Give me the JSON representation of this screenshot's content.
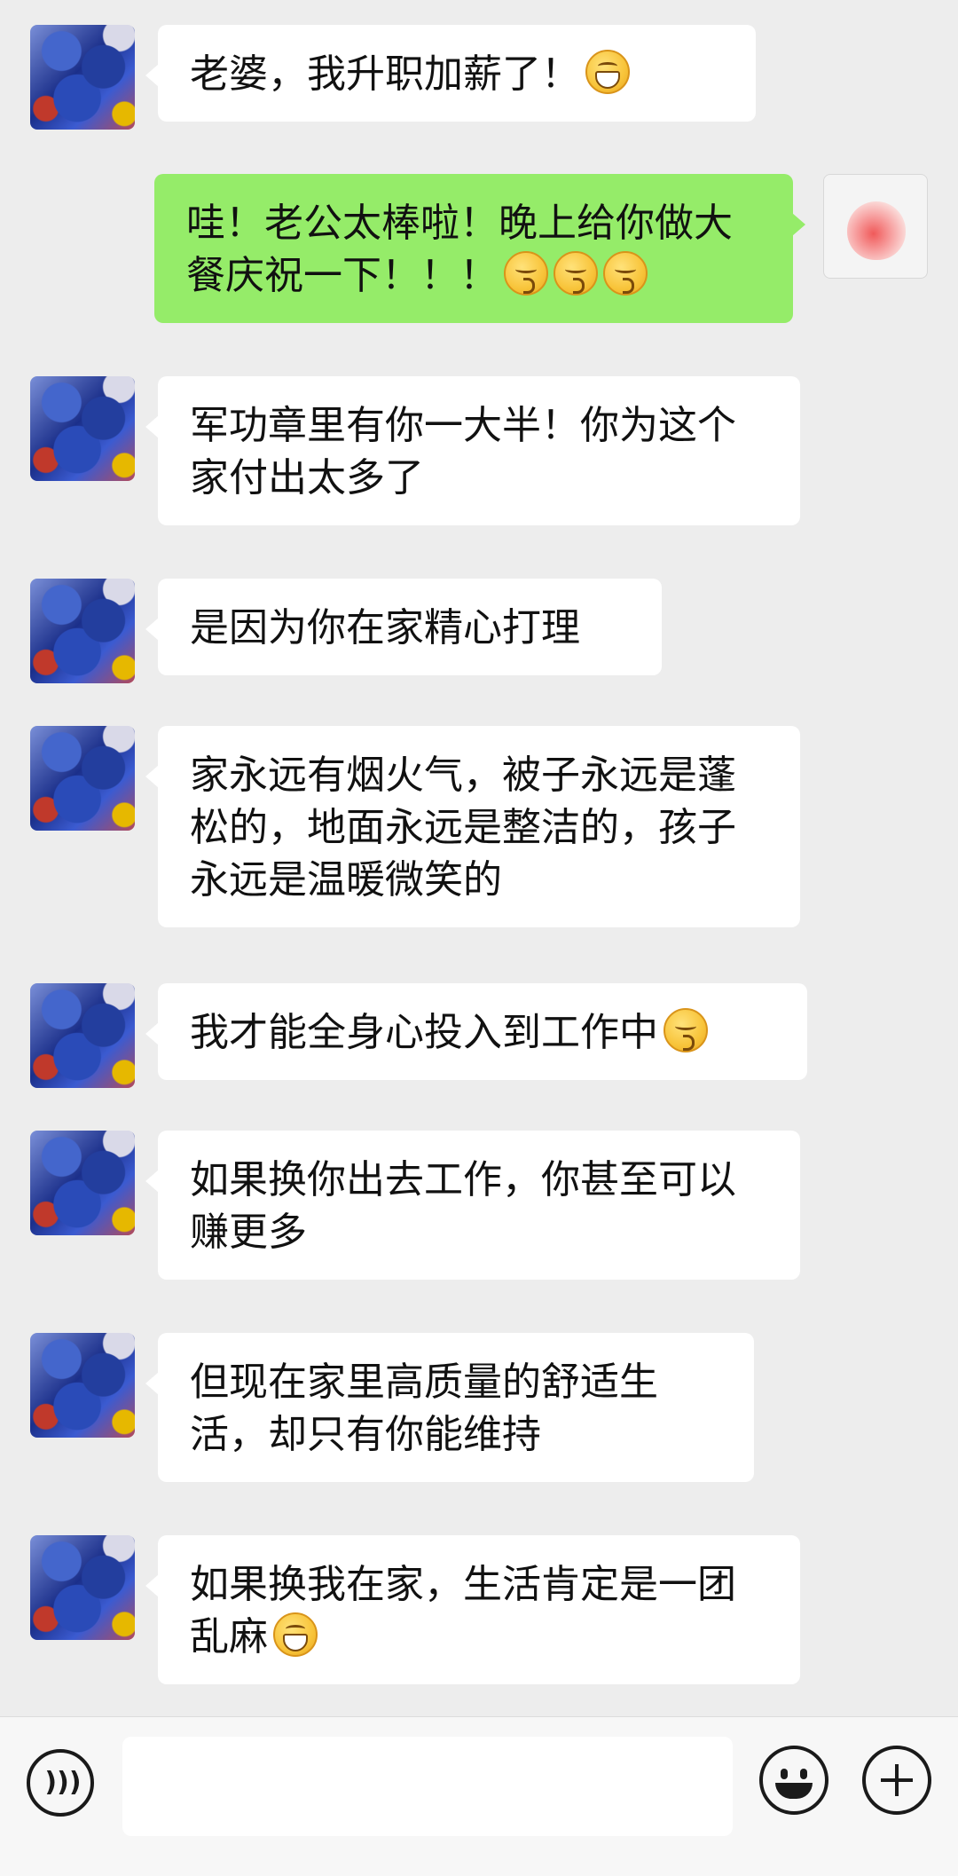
{
  "messages": [
    {
      "side": "left",
      "text": "老婆，我升职加薪了！",
      "emojis": [
        "grin"
      ]
    },
    {
      "side": "right",
      "text": "哇！老公太棒啦！晚上给你做大餐庆祝一下！！！",
      "emojis": [
        "kiss",
        "kiss",
        "kiss"
      ]
    },
    {
      "side": "left",
      "text": "军功章里有你一大半！你为这个家付出太多了",
      "emojis": []
    },
    {
      "side": "left",
      "text": "是因为你在家精心打理",
      "emojis": []
    },
    {
      "side": "left",
      "text": "家永远有烟火气，被子永远是蓬松的，地面永远是整洁的，孩子永远是温暖微笑的",
      "emojis": []
    },
    {
      "side": "left",
      "text": "我才能全身心投入到工作中",
      "emojis": [
        "kiss"
      ]
    },
    {
      "side": "left",
      "text": "如果换你出去工作，你甚至可以赚更多",
      "emojis": []
    },
    {
      "side": "left",
      "text": "但现在家里高质量的舒适生活，却只有你能维持",
      "emojis": []
    },
    {
      "side": "left",
      "text": "如果换我在家，生活肯定是一团乱麻",
      "emojis": [
        "grin"
      ]
    }
  ],
  "input": {
    "value": "",
    "placeholder": ""
  },
  "icons": {
    "voice": "voice-icon",
    "emoji": "emoji-icon",
    "plus": "plus-icon",
    "avatar_left": "elephant-painting-avatar",
    "avatar_right": "peach-avatar"
  },
  "colors": {
    "background": "#ededed",
    "incoming_bubble": "#ffffff",
    "outgoing_bubble": "#95ec69"
  }
}
